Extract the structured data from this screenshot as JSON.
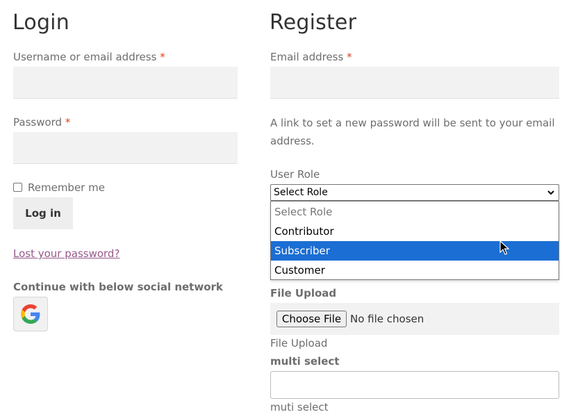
{
  "login": {
    "heading": "Login",
    "username_label": "Username or email address",
    "password_label": "Password",
    "required_mark": "*",
    "remember_label": "Remember me",
    "login_button": "Log in",
    "lost_password_link": "Lost your password?",
    "social_label": "Continue with below social network",
    "social_icon": "google-icon"
  },
  "register": {
    "heading": "Register",
    "email_label": "Email address",
    "required_mark": "*",
    "info_line1": "A link to set a new password will be sent to your email",
    "info_line2": "address.",
    "user_role_label": "User Role",
    "user_role_selected": "Select Role",
    "user_role_options": [
      "Select Role",
      "Contributor",
      "Subscriber",
      "Customer"
    ],
    "highlighted_option": "Subscriber",
    "file_upload_label": "File Upload",
    "choose_file_button": "Choose File",
    "no_file_text": "No file chosen",
    "file_upload_caption": "File Upload",
    "multi_select_label": "multi select",
    "multi_select_caption": "muti select"
  },
  "colors": {
    "required": "#e2401c",
    "link": "#96588a",
    "highlight": "#1b6ed3",
    "field_bg": "#f2f2f2"
  }
}
